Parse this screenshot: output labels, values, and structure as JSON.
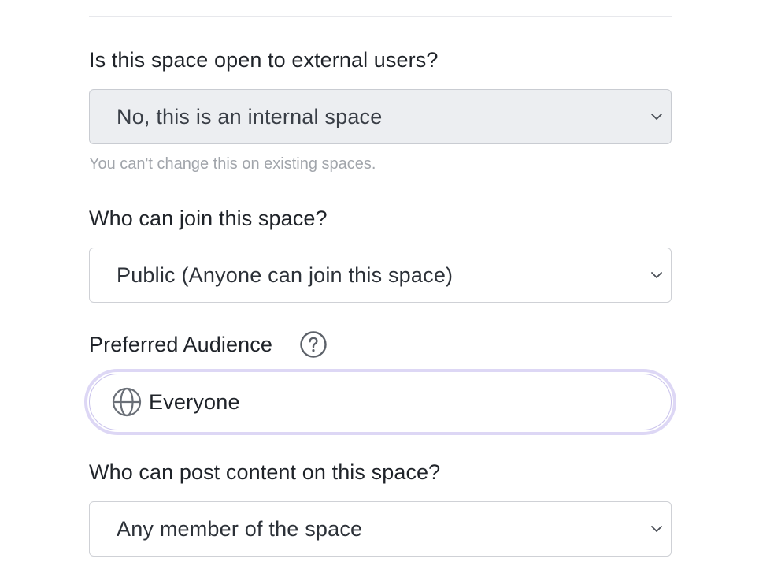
{
  "fields": {
    "external": {
      "label": "Is this space open to external users?",
      "value": "No, this is an internal space",
      "helper": "You can't change this on existing spaces."
    },
    "join": {
      "label": "Who can join this space?",
      "value": "Public (Anyone can join this space)"
    },
    "audience": {
      "label": "Preferred Audience",
      "value": "Everyone",
      "help_icon": "question-circle-icon",
      "value_icon": "globe-icon"
    },
    "post": {
      "label": "Who can post content on this space?",
      "value": "Any member of the space"
    }
  },
  "colors": {
    "focus_ring": "#ddd7f5",
    "disabled_bg": "#eceef1",
    "border": "#cfd1d6",
    "helper_text": "#a1a5ab"
  }
}
